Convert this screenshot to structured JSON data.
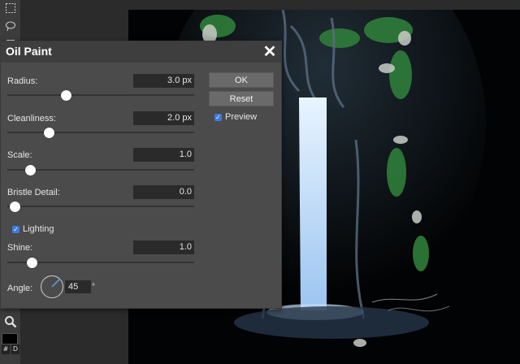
{
  "toolbar": {
    "tools": [
      {
        "icon": "marquee-icon"
      },
      {
        "icon": "lasso-icon"
      },
      {
        "icon": "move-icon"
      },
      {
        "icon": "zoom-icon"
      }
    ],
    "mini_left": "#",
    "mini_right": "D"
  },
  "dialog": {
    "title": "Oil Paint",
    "close_icon": "close-icon",
    "radius": {
      "label": "Radius:",
      "value": "3.0 px",
      "slider_fraction": 0.32
    },
    "cleanliness": {
      "label": "Cleanliness:",
      "value": "2.0 px",
      "slider_fraction": 0.22
    },
    "scale": {
      "label": "Scale:",
      "value": "1.0",
      "slider_fraction": 0.12
    },
    "bristle_detail": {
      "label": "Bristle Detail:",
      "value": "0.0",
      "slider_fraction": 0.0
    },
    "lighting": {
      "label": "Lighting",
      "checked": true
    },
    "shine": {
      "label": "Shine:",
      "value": "1.0",
      "slider_fraction": 0.13
    },
    "angle": {
      "label": "Angle:",
      "value": "45",
      "unit": "°"
    },
    "ok_label": "OK",
    "reset_label": "Reset",
    "preview": {
      "label": "Preview",
      "checked": true
    }
  },
  "colors": {
    "accent": "#3d7be0",
    "dialog_bg": "#4b4b4b",
    "header_bg": "#3e3e3e"
  }
}
